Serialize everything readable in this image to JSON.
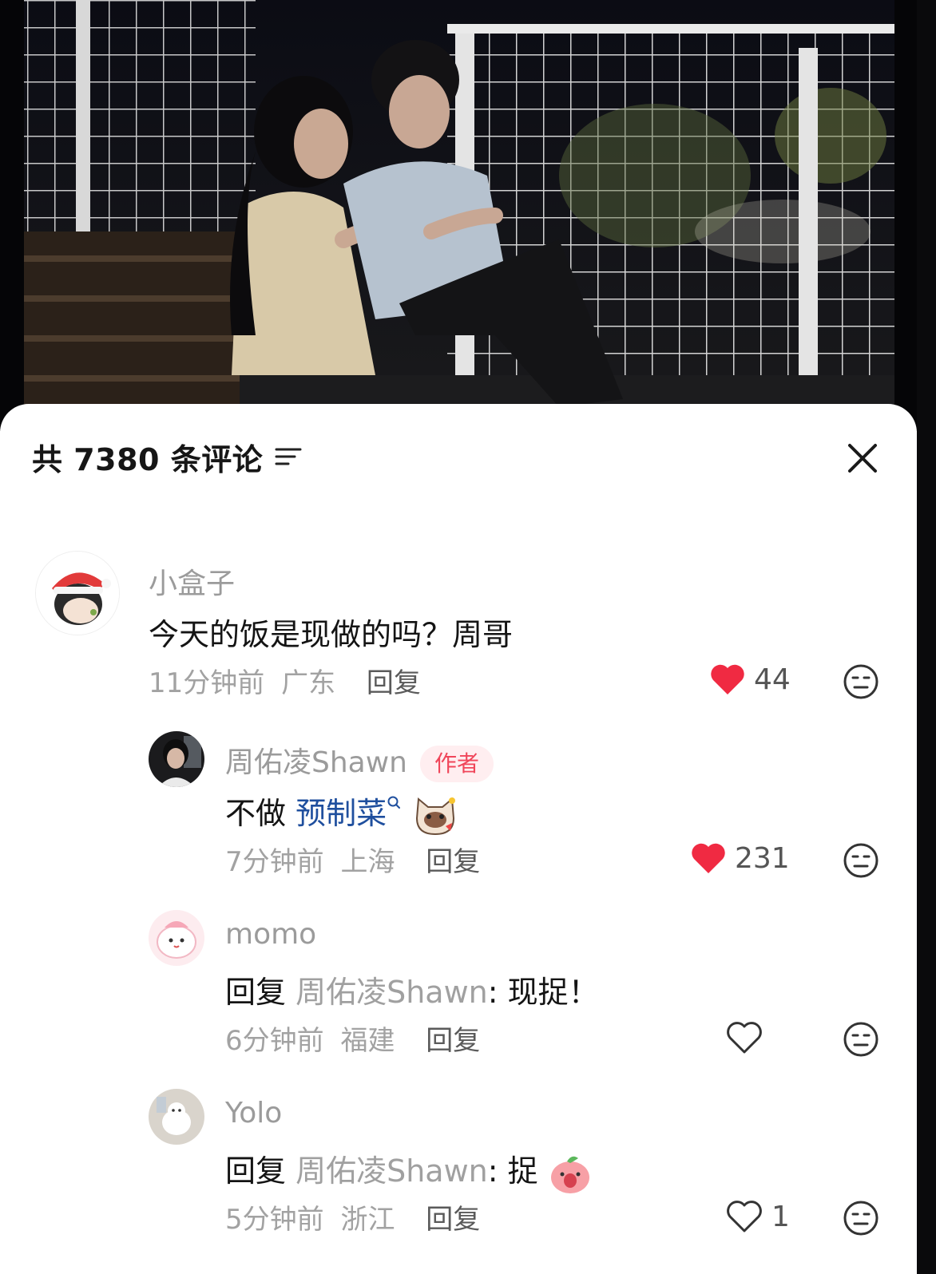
{
  "header": {
    "title": "共 7380 条评论"
  },
  "comments": [
    {
      "username": "小盒子",
      "text": "今天的饭是现做的吗？周哥",
      "time": "11分钟前",
      "location": "广东",
      "reply_label": "回复",
      "likes": "44",
      "liked": true
    },
    {
      "username": "周佑凌Shawn",
      "badge": "作者",
      "text_prefix": "不做 ",
      "topic": "预制菜",
      "time": "7分钟前",
      "location": "上海",
      "reply_label": "回复",
      "likes": "231",
      "liked": true
    },
    {
      "username": "momo",
      "reply_prefix": "回复 ",
      "mention": "周佑凌Shawn",
      "text": ": 现捉！",
      "time": "6分钟前",
      "location": "福建",
      "reply_label": "回复",
      "liked": false
    },
    {
      "username": "Yolo",
      "reply_prefix": "回复 ",
      "mention": "周佑凌Shawn",
      "text": ": 捉",
      "time": "5分钟前",
      "location": "浙江",
      "reply_label": "回复",
      "likes": "1",
      "liked": false
    }
  ],
  "colors": {
    "like_red": "#f02a42",
    "topic_blue": "#1f4f9e",
    "badge_bg": "#ffeef0",
    "badge_text": "#f0465a"
  },
  "icons": [
    "filter-icon",
    "close-icon",
    "heart-icon",
    "dislike-face-icon"
  ]
}
